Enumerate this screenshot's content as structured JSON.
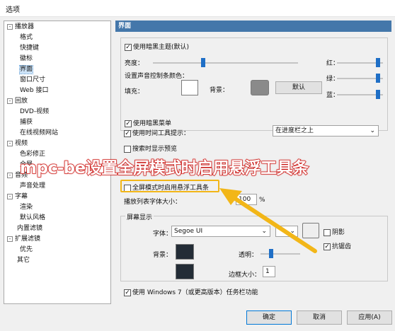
{
  "window_title": "选项",
  "tree": [
    {
      "label": "播放器",
      "level": 0,
      "expander": "-"
    },
    {
      "label": "格式",
      "level": 1
    },
    {
      "label": "快捷键",
      "level": 1
    },
    {
      "label": "徽标",
      "level": 1
    },
    {
      "label": "界面",
      "level": 1,
      "selected": true
    },
    {
      "label": "窗口尺寸",
      "level": 1
    },
    {
      "label": "Web 接口",
      "level": 1
    },
    {
      "label": "回放",
      "level": 0,
      "expander": "-"
    },
    {
      "label": "DVD-视频",
      "level": 1
    },
    {
      "label": "捕获",
      "level": 1
    },
    {
      "label": "在线视频网站",
      "level": 1
    },
    {
      "label": "视频",
      "level": 0,
      "expander": "-"
    },
    {
      "label": "色彩修正",
      "level": 1
    },
    {
      "label": "全屏",
      "level": 1
    },
    {
      "label": "音频",
      "level": 0,
      "expander": "-"
    },
    {
      "label": "声音处理",
      "level": 1
    },
    {
      "label": "字幕",
      "level": 0,
      "expander": "-"
    },
    {
      "label": "渲染",
      "level": 1
    },
    {
      "label": "默认风格",
      "level": 1
    },
    {
      "label": "内置滤镜",
      "level": 0
    },
    {
      "label": "扩展滤镜",
      "level": 0,
      "expander": "-"
    },
    {
      "label": "优先",
      "level": 1
    },
    {
      "label": "其它",
      "level": 0
    }
  ],
  "panel_title": "界面",
  "theme": {
    "dark_theme_label": "使用暗黑主题(默认)",
    "brightness_label": "亮度：",
    "red_label": "红：",
    "green_label": "绿：",
    "blue_label": "蓝：",
    "volume_color_label": "设置声音控制条颜色：",
    "fill_label": "填充：",
    "background_label": "背景：",
    "default_button": "默认",
    "dark_menu_label": "使用暗黑菜单",
    "fill_color": "#ffffff",
    "bg_color": "#8a8a8a"
  },
  "time_tooltip_label": "使用时间工具提示：",
  "time_tooltip_value": "在进度栏之上",
  "preview_label": "搜索时显示预览",
  "fullscreen_toolbar_label": "全屏模式时启用悬浮工具条",
  "playlist_font_label": "播放列表字体大小：",
  "playlist_font_value": "100",
  "percent_unit": "%",
  "osd": {
    "title": "屏幕显示",
    "font_label": "字体：",
    "font_value": "Segoe UI",
    "shadow_label": "阴影",
    "antialias_label": "抗锯齿",
    "background_label": "背景：",
    "transparency_label": "透明：",
    "border_label": "边框大小：",
    "border_value": "1",
    "bg_color": "#232c36",
    "border_color": "#232c36"
  },
  "win7_label": "使用 Windows 7（或更高版本）任务栏功能",
  "buttons": {
    "ok": "确定",
    "cancel": "取消",
    "apply": "应用(A)"
  },
  "overlay_caption": "mpc-be设置全屏模式时启用悬浮工具条",
  "colors": {
    "header": "#4477aa",
    "accent": "#1f6fc6",
    "highlight": "#f2b618",
    "caption": "#d92620"
  }
}
